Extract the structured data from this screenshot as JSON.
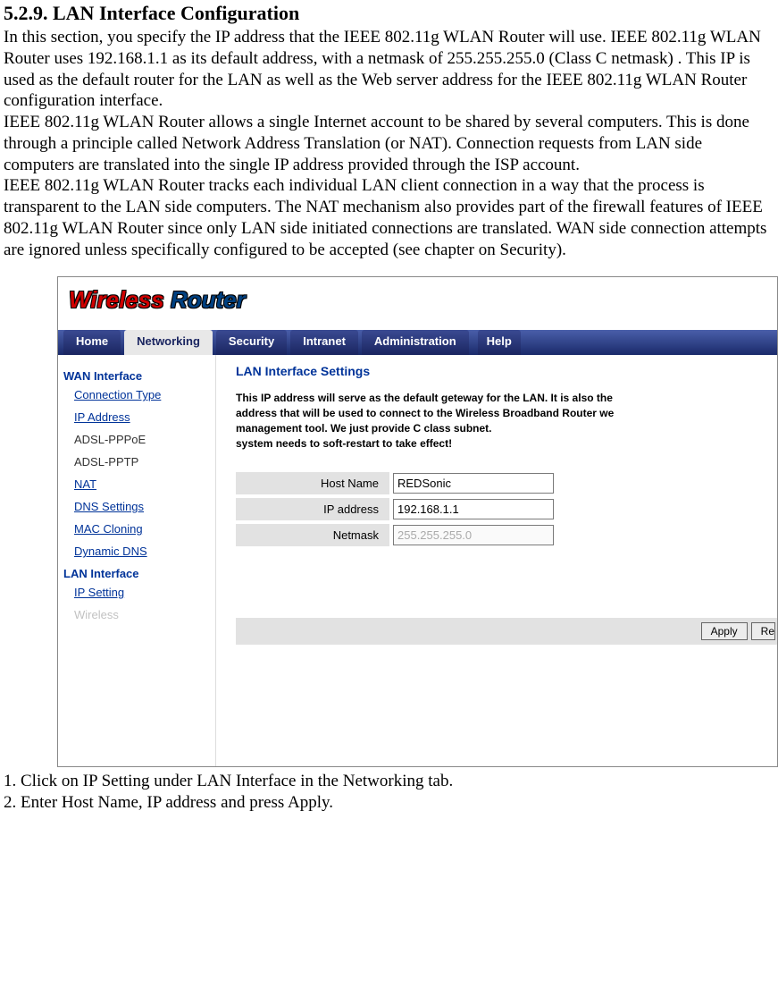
{
  "section": {
    "heading": "5.2.9. LAN Interface Configuration",
    "para1": "In this section, you specify the IP address that the IEEE 802.11g WLAN Router will use. IEEE 802.11g WLAN Router uses 192.168.1.1 as its default address, with a netmask of 255.255.255.0 (Class C netmask) . This IP is used as the default router for the LAN as well as the Web server address for the IEEE 802.11g WLAN Router configuration interface.",
    "para2": "IEEE 802.11g WLAN Router allows a single Internet account to be shared by several computers. This is done through a principle called Network Address Translation (or NAT). Connection requests from LAN side computers are translated into the single IP address provided through the ISP account.",
    "para3": "IEEE 802.11g WLAN Router tracks each individual LAN client connection in a way that the process is transparent to the LAN side computers. The NAT mechanism also provides part of the firewall features of IEEE 802.11g WLAN Router since only LAN side initiated connections are translated. WAN side connection attempts are ignored unless specifically configured to be accepted (see chapter on Security)."
  },
  "screenshot": {
    "logo_wireless": "Wireless",
    "logo_router": " Router",
    "nav": {
      "home": "Home",
      "networking": "Networking",
      "security": "Security",
      "intranet": "Intranet",
      "administration": "Administration",
      "help": "Help"
    },
    "sidebar": {
      "wan_section": "WAN Interface",
      "items_wan": {
        "connection_type": "Connection Type",
        "ip_address": "IP Address",
        "adsl_pppoe": "ADSL-PPPoE",
        "adsl_pptp": "ADSL-PPTP",
        "nat": "NAT",
        "dns_settings": "DNS Settings",
        "mac_cloning": "MAC Cloning",
        "dynamic_dns": "Dynamic DNS"
      },
      "lan_section": "LAN Interface",
      "items_lan": {
        "ip_setting": "IP Setting",
        "wireless": "Wireless"
      }
    },
    "panel": {
      "title": "LAN Interface Settings",
      "desc_line1": "This IP address will serve as the default geteway for the LAN. It is also the",
      "desc_line2": "address that will be used to connect to the Wireless Broadband Router we",
      "desc_line3": "management tool. We just provide C class subnet.",
      "desc_line4": "system needs to soft-restart to take effect!",
      "labels": {
        "host_name": "Host Name",
        "ip_address": "IP address",
        "netmask": "Netmask"
      },
      "values": {
        "host_name": "REDSonic",
        "ip_address": "192.168.1.1",
        "netmask": "255.255.255.0"
      },
      "apply_btn": "Apply",
      "reset_btn": "Re"
    }
  },
  "steps": {
    "s1": "1. Click on IP Setting under LAN Interface in the Networking tab.",
    "s2": "2. Enter Host Name, IP address and press Apply."
  }
}
